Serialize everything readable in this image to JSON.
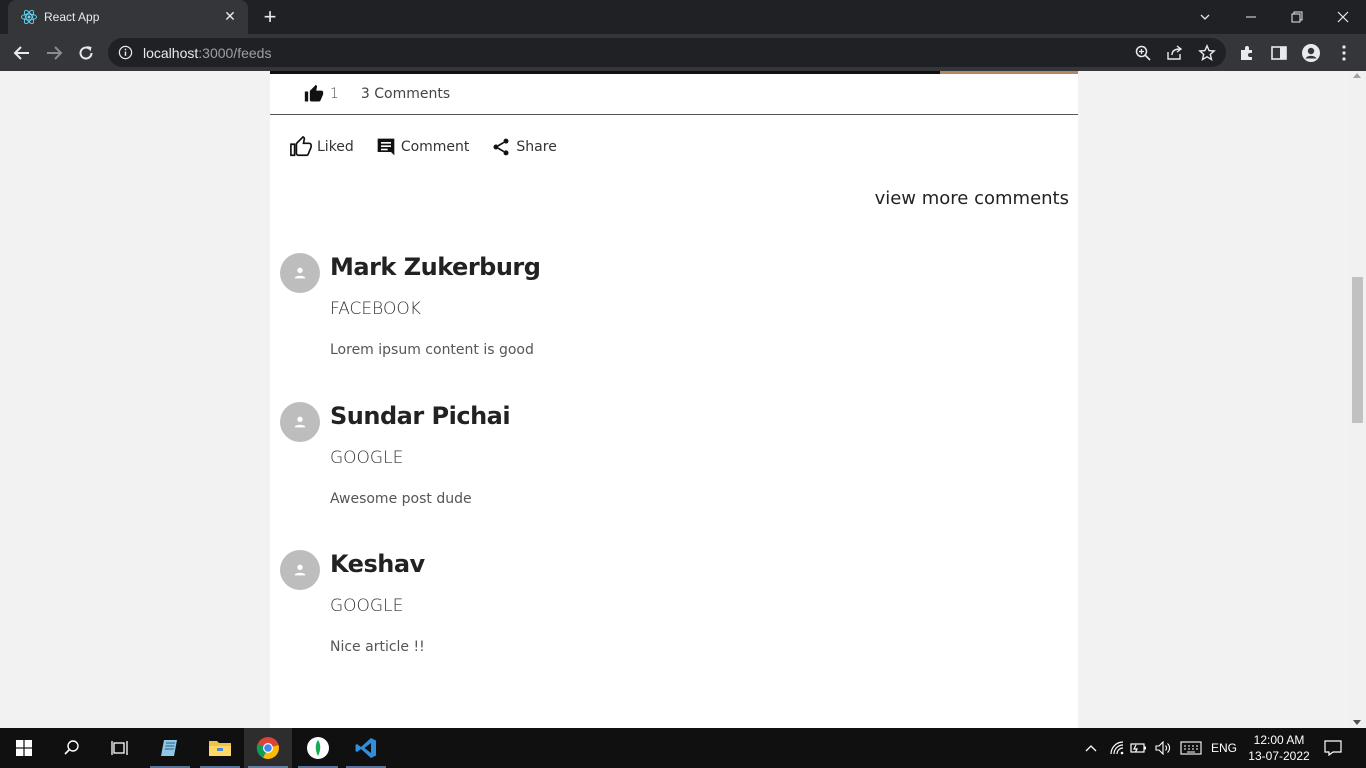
{
  "browser": {
    "tab_title": "React App",
    "url_host": "localhost",
    "url_rest": ":3000/feeds"
  },
  "post": {
    "like_count": "1",
    "comments_count_label": "3 Comments",
    "actions": {
      "liked": "Liked",
      "comment": "Comment",
      "share": "Share"
    },
    "view_more_label": "view more comments"
  },
  "comments": [
    {
      "name": "Mark Zukerburg",
      "company": "FACEBOOK",
      "text": "Lorem ipsum content is good"
    },
    {
      "name": "Sundar Pichai",
      "company": "GOOGLE",
      "text": "Awesome post dude"
    },
    {
      "name": "Keshav",
      "company": "GOOGLE",
      "text": "Nice article !!"
    }
  ],
  "taskbar": {
    "language": "ENG",
    "time": "12:00 AM",
    "date": "13-07-2022"
  },
  "colors": {
    "chrome_dark": "#202124",
    "chrome_toolbar": "#35363a",
    "page_bg": "#f2f2f2",
    "card_bg": "#ffffff",
    "avatar_bg": "#bdbdbd"
  }
}
